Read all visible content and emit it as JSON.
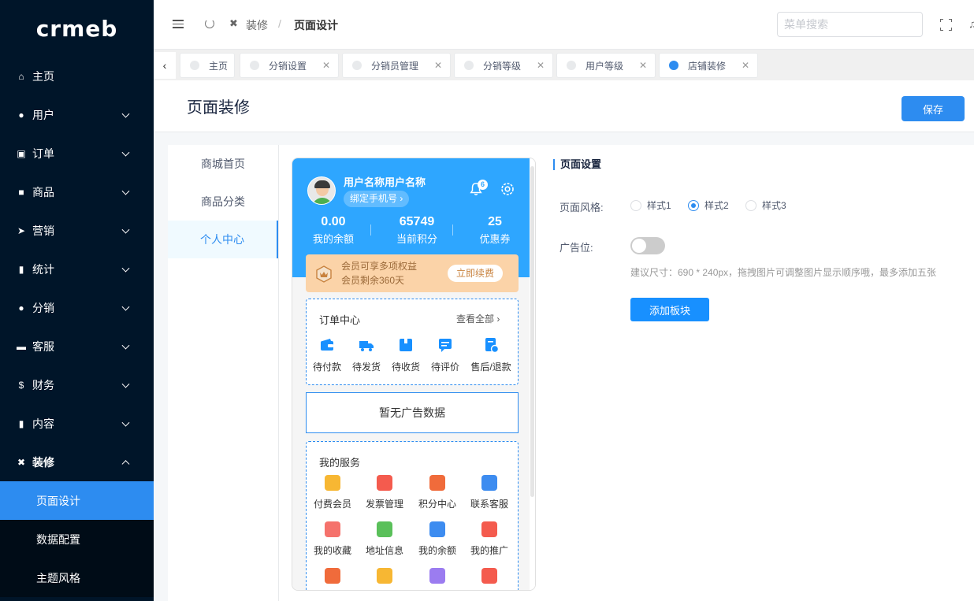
{
  "app": {
    "logo_text": "crmeb"
  },
  "sidebar": {
    "items": [
      {
        "label": "主页",
        "icon": "home-icon"
      },
      {
        "label": "用户",
        "icon": "user-icon"
      },
      {
        "label": "订单",
        "icon": "cart-icon"
      },
      {
        "label": "商品",
        "icon": "bag-icon"
      },
      {
        "label": "营销",
        "icon": "send-icon"
      },
      {
        "label": "统计",
        "icon": "bar-chart-icon"
      },
      {
        "label": "分销",
        "icon": "group-icon"
      },
      {
        "label": "客服",
        "icon": "chat-icon"
      },
      {
        "label": "财务",
        "icon": "dollar-icon"
      },
      {
        "label": "内容",
        "icon": "book-icon"
      },
      {
        "label": "装修",
        "icon": "tools-icon"
      }
    ],
    "subitems": [
      {
        "label": "页面设计",
        "active": true
      },
      {
        "label": "数据配置"
      },
      {
        "label": "主题风格"
      }
    ]
  },
  "header": {
    "breadcrumb_parent": "装修",
    "breadcrumb_sep": "/",
    "breadcrumb_current": "页面设计",
    "search_placeholder": "菜单搜索"
  },
  "tabs": [
    {
      "label": "主页"
    },
    {
      "label": "分销设置"
    },
    {
      "label": "分销员管理"
    },
    {
      "label": "分销等级"
    },
    {
      "label": "用户等级"
    },
    {
      "label": "店铺装修",
      "active": true
    }
  ],
  "page": {
    "title": "页面装修",
    "save_label": "保存"
  },
  "leftnav": [
    {
      "label": "商城首页"
    },
    {
      "label": "商品分类"
    },
    {
      "label": "个人中心",
      "active": true
    }
  ],
  "preview": {
    "username": "用户名称用户名称",
    "bind_phone": "绑定手机号 ›",
    "notice_count": "6",
    "stats": [
      {
        "value": "0.00",
        "label": "我的余额"
      },
      {
        "value": "65749",
        "label": "当前积分"
      },
      {
        "value": "25",
        "label": "优惠券"
      }
    ],
    "vip": {
      "line1": "会员可享多项权益",
      "line2": "会员剩余360天",
      "button": "立即续费"
    },
    "order": {
      "title": "订单中心",
      "view_all": "查看全部 ›",
      "items": [
        {
          "label": "待付款",
          "icon": "wallet-icon"
        },
        {
          "label": "待发货",
          "icon": "truck-icon"
        },
        {
          "label": "待收货",
          "icon": "package-icon"
        },
        {
          "label": "待评价",
          "icon": "comment-icon"
        },
        {
          "label": "售后/退款",
          "icon": "refund-icon"
        }
      ]
    },
    "ad_empty": "暂无广告数据",
    "service": {
      "title": "我的服务",
      "items": [
        {
          "label": "付费会员",
          "color": "#f7b733"
        },
        {
          "label": "发票管理",
          "color": "#f45b4e"
        },
        {
          "label": "积分中心",
          "color": "#f06b3b"
        },
        {
          "label": "联系客服",
          "color": "#3d8cf0"
        },
        {
          "label": "我的收藏",
          "color": "#f5726c"
        },
        {
          "label": "地址信息",
          "color": "#5ac05a"
        },
        {
          "label": "我的余额",
          "color": "#3d8cf0"
        },
        {
          "label": "我的推广",
          "color": "#f45b4e"
        },
        {
          "label": "",
          "color": "#f06b3b"
        },
        {
          "label": "",
          "color": "#f7b733"
        },
        {
          "label": "",
          "color": "#9b7cf0"
        },
        {
          "label": "",
          "color": "#f45b4e"
        }
      ]
    }
  },
  "settings": {
    "title": "页面设置",
    "style_label": "页面风格:",
    "styles": [
      "样式1",
      "样式2",
      "样式3"
    ],
    "selected_style": "样式2",
    "ad_label": "广告位:",
    "ad_enabled": false,
    "hint": "建议尺寸：690 * 240px，拖拽图片可调整图片显示顺序哦，最多添加五张",
    "add_button": "添加板块"
  }
}
